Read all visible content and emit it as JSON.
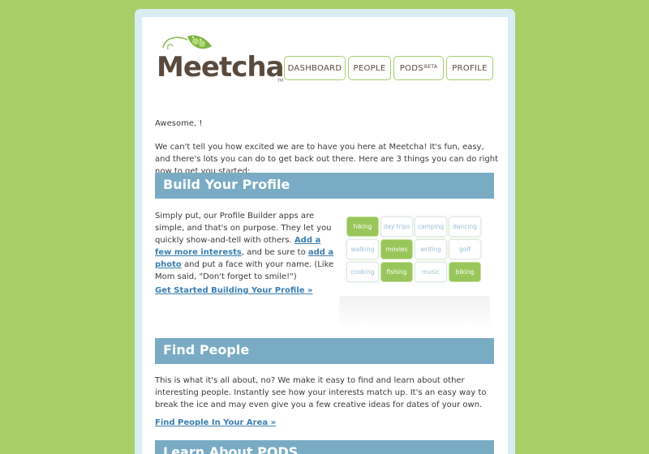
{
  "brand": {
    "logo_text": "Meetcha",
    "logo_tm": "TM",
    "brand_green": "#a6cf68",
    "bar_blue": "#7aabc4",
    "link_blue": "#3b7fb0"
  },
  "nav": {
    "items": [
      {
        "label": "DASHBOARD"
      },
      {
        "label": "PEOPLE"
      },
      {
        "label": "PODS",
        "sup": "BETA"
      },
      {
        "label": "PROFILE"
      }
    ]
  },
  "intro": {
    "greeting": "Awesome, !",
    "paragraph": "We can't tell you how excited we are to have you here at Meetcha! It's fun, easy, and there's lots you can do to get back out there. Here are 3 things you can do right now to get you started:"
  },
  "build_profile": {
    "heading": "Build Your Profile",
    "text_1": "Simply put, our Profile Builder apps are simple, and that's on purpose. They let you quickly show-and-tell with others.",
    "link_1": "Add a few more interests",
    "text_2": ", and be sure to",
    "link_2": "add a photo",
    "text_3": "and put a face with your name. (Like Mom said, \"Don't forget to smile!\")",
    "cta": "Get Started Building Your Profile »",
    "tiles": [
      {
        "label": "hiking",
        "selected": true
      },
      {
        "label": "day trips",
        "selected": false
      },
      {
        "label": "camping",
        "selected": false
      },
      {
        "label": "dancing",
        "selected": false
      },
      {
        "label": "walking",
        "selected": false
      },
      {
        "label": "movies",
        "selected": true
      },
      {
        "label": "writing",
        "selected": false
      },
      {
        "label": "golf",
        "selected": false
      },
      {
        "label": "cooking",
        "selected": false
      },
      {
        "label": "fishing",
        "selected": true
      },
      {
        "label": "music",
        "selected": false
      },
      {
        "label": "biking",
        "selected": true
      }
    ]
  },
  "find_people": {
    "heading": "Find People",
    "paragraph": "This is what it's all about, no? We make it easy to find and learn about other interesting people. Instantly see how your interests match up. It's an easy way to break the ice and may even give you a few creative ideas for dates of your own.",
    "cta": "Find People In Your Area »"
  },
  "pods": {
    "heading": "Learn About PODS"
  }
}
